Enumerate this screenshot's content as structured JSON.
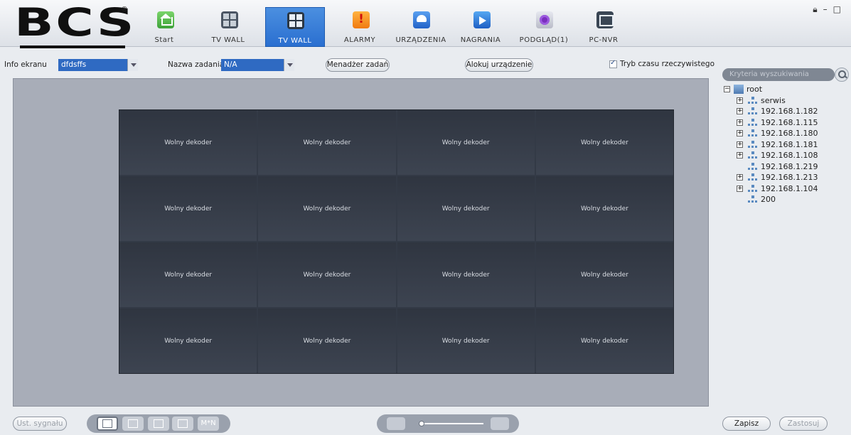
{
  "app": {
    "logo_text": "BCS",
    "logo_mark": "®",
    "window_controls": [
      "lock-icon",
      "minimize-icon",
      "maximize-icon"
    ]
  },
  "nav": {
    "tabs": [
      {
        "label": "Start",
        "icon": "home-icon",
        "active": false
      },
      {
        "label": "TV WALL",
        "icon": "tvwall-settings-icon",
        "active": false
      },
      {
        "label": "TV WALL",
        "icon": "tvwall-icon",
        "active": true
      },
      {
        "label": "ALARMY",
        "icon": "alarm-icon",
        "active": false
      },
      {
        "label": "URZĄDZENIA",
        "icon": "device-icon",
        "active": false
      },
      {
        "label": "NAGRANIA",
        "icon": "recording-icon",
        "active": false
      },
      {
        "label": "PODGLĄD(1)",
        "icon": "preview-icon",
        "active": false
      },
      {
        "label": "PC-NVR",
        "icon": "pc-nvr-icon",
        "active": false
      }
    ]
  },
  "toolbar": {
    "screen_info_label": "Info ekranu",
    "screen_info_value": "dfdsffs",
    "task_name_label": "Nazwa zadania",
    "task_name_value": "N/A",
    "task_manager_button": "Menadżer zadań",
    "allocate_device_button": "Alokuj urządzenie",
    "realtime_checkbox_label": "Tryb czasu rzeczywistego",
    "realtime_checked": true
  },
  "wall": {
    "rows": 4,
    "columns": 4,
    "cells": [
      "Wolny dekoder",
      "Wolny dekoder",
      "Wolny dekoder",
      "Wolny dekoder",
      "Wolny dekoder",
      "Wolny dekoder",
      "Wolny dekoder",
      "Wolny dekoder",
      "Wolny dekoder",
      "Wolny dekoder",
      "Wolny dekoder",
      "Wolny dekoder",
      "Wolny dekoder",
      "Wolny dekoder",
      "Wolny dekoder",
      "Wolny dekoder"
    ]
  },
  "sidebar": {
    "search_placeholder": "Kryteria wyszukiwania",
    "tree": [
      {
        "label": "root",
        "level": 0,
        "expander": "−",
        "icon": "root-icon"
      },
      {
        "label": "serwis",
        "level": 1,
        "expander": "+",
        "icon": "network-icon"
      },
      {
        "label": "192.168.1.182",
        "level": 1,
        "expander": "+",
        "icon": "network-icon"
      },
      {
        "label": "192.168.1.115",
        "level": 1,
        "expander": "+",
        "icon": "network-icon"
      },
      {
        "label": "192.168.1.180",
        "level": 1,
        "expander": "+",
        "icon": "network-icon"
      },
      {
        "label": "192.168.1.181",
        "level": 1,
        "expander": "+",
        "icon": "network-icon"
      },
      {
        "label": "192.168.1.108",
        "level": 1,
        "expander": "+",
        "icon": "network-icon"
      },
      {
        "label": "192.168.1.219",
        "level": 1,
        "expander": "",
        "icon": "network-icon"
      },
      {
        "label": "192.168.1.213",
        "level": 1,
        "expander": "+",
        "icon": "network-icon"
      },
      {
        "label": "192.168.1.104",
        "level": 1,
        "expander": "+",
        "icon": "network-icon"
      },
      {
        "label": "200",
        "level": 1,
        "expander": "",
        "icon": "network-icon"
      }
    ]
  },
  "bottom": {
    "signal_settings_button": "Ust. sygnału",
    "layout_custom_label": "M*N",
    "save_button": "Zapisz",
    "apply_button": "Zastosuj"
  }
}
